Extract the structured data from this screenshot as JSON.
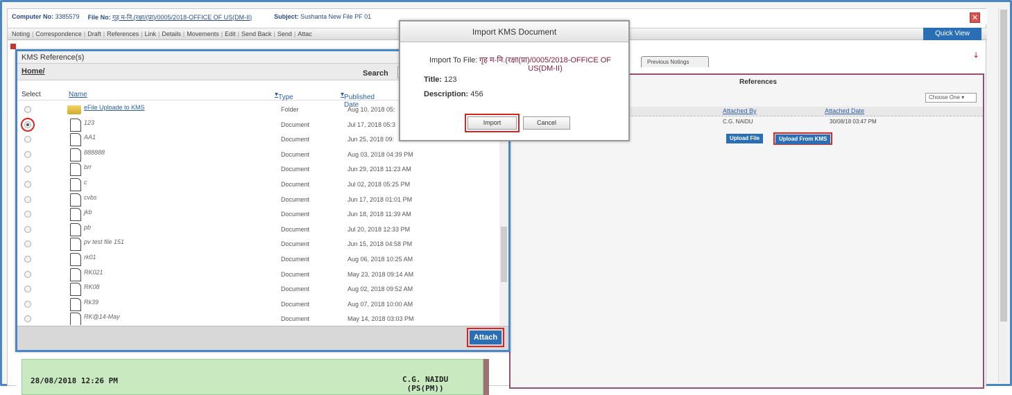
{
  "header": {
    "computer_no_label": "Computer No:",
    "computer_no": "3385579",
    "file_no_label": "File No:",
    "file_no": "गृह म-नि.(रक्षा/(प्रा)/0005/2018-OFFICE OF US(DM-II)",
    "subject_label": "Subject:",
    "subject": "Sushanta New File PF 01"
  },
  "menu": [
    "Noting",
    "Correspondence",
    "Draft",
    "References",
    "Link",
    "Details",
    "Movements",
    "Edit",
    "Send Back",
    "Send",
    "Attac"
  ],
  "quick_view": "Quick View",
  "previous_notings_tab": "Previous Notings",
  "references": {
    "title": "References",
    "choose_one": "Choose One",
    "columns": {
      "attached_by": "Attached By",
      "attached_date": "Attached Date"
    },
    "row": {
      "attached_by": "C.G. NAIDU",
      "attached_date": "30/08/18 03:47 PM"
    },
    "upload_file": "Upload File",
    "upload_from_kms": "Upload From KMS"
  },
  "kms": {
    "title": "KMS Reference(s)",
    "home": "Home/",
    "search_label": "Search",
    "columns": {
      "select": "Select",
      "name": "Name",
      "type": "Type",
      "published": "Published Date"
    },
    "rows": [
      {
        "name": "eFile Uploade to KMS",
        "type": "Folder",
        "date": "Aug 10, 2018 05:"
      },
      {
        "name": "123",
        "type": "Document",
        "date": "Jul 17, 2018 05:3"
      },
      {
        "name": "AA1",
        "type": "Document",
        "date": "Jun 25, 2018 09:"
      },
      {
        "name": "888888",
        "type": "Document",
        "date": "Aug 03, 2018 04:39 PM"
      },
      {
        "name": "brr",
        "type": "Document",
        "date": "Jun 29, 2018 11:23 AM"
      },
      {
        "name": "c",
        "type": "Document",
        "date": "Jul 02, 2018 05:25 PM"
      },
      {
        "name": "cvbs",
        "type": "Document",
        "date": "Jun 17, 2018 01:01 PM"
      },
      {
        "name": "jkb",
        "type": "Document",
        "date": "Jun 18, 2018 11:39 AM"
      },
      {
        "name": "pb",
        "type": "Document",
        "date": "Jul 20, 2018 12:33 PM"
      },
      {
        "name": "pv test file 151",
        "type": "Document",
        "date": "Jun 15, 2018 04:58 PM"
      },
      {
        "name": "rk01",
        "type": "Document",
        "date": "Aug 06, 2018 10:25 AM"
      },
      {
        "name": "RK021",
        "type": "Document",
        "date": "May 23, 2018 09:14 AM"
      },
      {
        "name": "RK08",
        "type": "Document",
        "date": "Aug 02, 2018 09:52 AM"
      },
      {
        "name": "Rk39",
        "type": "Document",
        "date": "Aug 07, 2018 10:00 AM"
      },
      {
        "name": "RK@14-May",
        "type": "Document",
        "date": "May 14, 2018 03:03 PM"
      }
    ],
    "selected_row": 1,
    "attach": "Attach"
  },
  "import_dialog": {
    "title": "Import KMS Document",
    "import_to_label": "Import To File:",
    "import_to_value": "गृह म-नि.(रक्षा(प्रा)/0005/2018-OFFICE OF US(DM-II)",
    "title_label": "Title:",
    "title_value": "123",
    "description_label": "Description:",
    "description_value": "456",
    "import_button": "Import",
    "cancel_button": "Cancel"
  },
  "noting": {
    "date": "28/08/2018 12:26 PM",
    "name": "C.G. NAIDU",
    "designation": "(PS(PM))"
  }
}
